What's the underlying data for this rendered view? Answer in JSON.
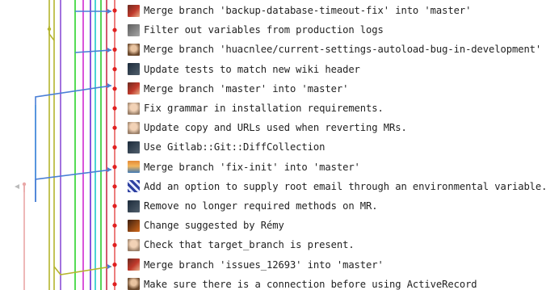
{
  "commits": [
    {
      "message": "Merge branch 'backup-database-timeout-fix' into 'master'",
      "avatar": "avatar-red"
    },
    {
      "message": "Filter out variables from production logs",
      "avatar": "avatar-gray"
    },
    {
      "message": "Merge branch 'huacnlee/current-settings-autoload-bug-in-development' into",
      "avatar": "avatar-person"
    },
    {
      "message": "Update tests to match new wiki header",
      "avatar": "avatar-dark"
    },
    {
      "message": "Merge branch 'master' into 'master'",
      "avatar": "avatar-red"
    },
    {
      "message": "Fix grammar in installation requirements.",
      "avatar": "avatar-light"
    },
    {
      "message": "Update copy and URLs used when reverting MRs.",
      "avatar": "avatar-light"
    },
    {
      "message": "Use Gitlab::Git::DiffCollection",
      "avatar": "avatar-dark"
    },
    {
      "message": "Merge branch 'fix-init' into 'master'",
      "avatar": "avatar-landscape"
    },
    {
      "message": "Add an option to supply root email through an environmental variable.",
      "avatar": "avatar-pattern"
    },
    {
      "message": "Remove no longer required methods on MR.",
      "avatar": "avatar-dark"
    },
    {
      "message": "Change suggested by Rémy",
      "avatar": "avatar-orange"
    },
    {
      "message": "Check that target_branch is present.",
      "avatar": "avatar-light"
    },
    {
      "message": "Merge branch 'issues_12693' into 'master'",
      "avatar": "avatar-red"
    },
    {
      "message": "Make sure there is a connection before using ActiveRecord",
      "avatar": "avatar-person"
    }
  ],
  "graph": {
    "lane_colors": [
      "#e9a7a7",
      "#e85d5d",
      "#b5b52e",
      "#8a4fd6",
      "#2d7bd6",
      "#2bd32b",
      "#d12bd1",
      "#6c2bd6",
      "#1ec9c9",
      "#2ec92e",
      "#c92e4a"
    ],
    "merge_arrow_color": "#4a7fd6",
    "head_dot_color": "#e02020"
  }
}
